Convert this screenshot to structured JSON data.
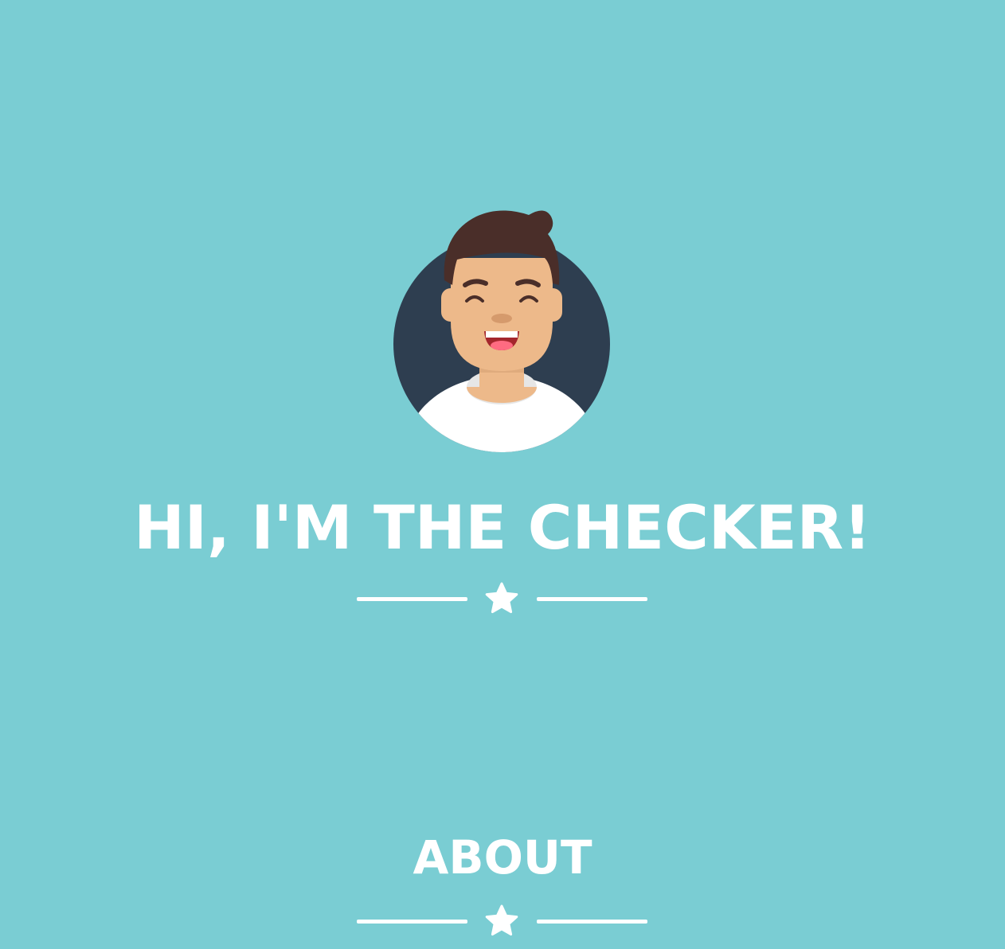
{
  "hero": {
    "title": "HI, I'M THE CHECKER!",
    "avatar_icon": "smiling-man-avatar",
    "divider_icon": "star-icon"
  },
  "about": {
    "title": "ABOUT",
    "divider_icon": "star-icon"
  },
  "colors": {
    "background": "#7ACDD3",
    "text": "#FFFFFF",
    "avatar_circle": "#2E3E50",
    "skin": "#EDB98A",
    "hair": "#4A2E29",
    "shirt": "#FFFFFF"
  }
}
